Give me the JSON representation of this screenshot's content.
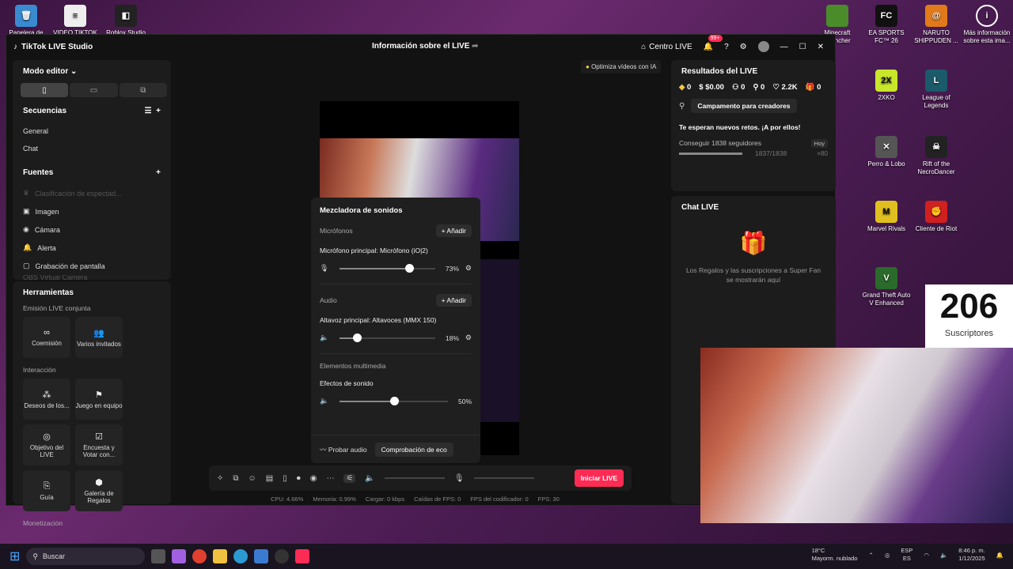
{
  "desktop": {
    "icons_left": [
      "Papelera de reciclaje",
      "VIDEO TIKTOK PC",
      "Roblox Studio"
    ],
    "icons_right": [
      {
        "label": "Minecraft Launcher",
        "color": "#4a8c2a"
      },
      {
        "label": "EA SPORTS FC™ 26",
        "color": "#111"
      },
      {
        "label": "NARUTO SHIPPUDEN ...",
        "color": "#e07a1a"
      },
      {
        "label": "Más información sobre esta ima...",
        "color": "#444"
      },
      {
        "label": "2XKO",
        "color": "#c8e62a"
      },
      {
        "label": "League of Legends",
        "color": "#1a5a6a"
      },
      {
        "label": "Perro & Lobo",
        "color": "#666"
      },
      {
        "label": "Rift of the NecroDancer",
        "color": "#222"
      },
      {
        "label": "Marvel Rivals",
        "color": "#e0c020"
      },
      {
        "label": "Cliente de Riot",
        "color": "#d02020"
      },
      {
        "label": "Grand Theft Auto V Enhanced",
        "color": "#2a6a2a"
      }
    ]
  },
  "window": {
    "app_title": "TikTok LIVE Studio",
    "center_title": "Información sobre el LIVE",
    "centro": "Centro LIVE",
    "notif": "99+"
  },
  "left": {
    "mode": "Modo editor",
    "sequences": "Secuencias",
    "seq_items": [
      "General",
      "Chat"
    ],
    "sources": "Fuentes",
    "source_items": [
      "Clasificación de espectad...",
      "Imagen",
      "Cámara",
      "Alerta",
      "Grabación de pantalla",
      "OBS Virtual Camera"
    ],
    "tools": "Herramientas",
    "cohost_title": "Emisión LIVE conjunta",
    "cohost": [
      "Coemisión",
      "Varios invitados"
    ],
    "interaction_title": "Interacción",
    "interaction": [
      "Deseos de los...",
      "Juego en equipo",
      "Objetivo del LIVE",
      "Encuesta y Votar con...",
      "Guía",
      "Galería de Regalos"
    ],
    "monet": "Monetización"
  },
  "center": {
    "ai_tip": "Optimiza vídeos con IA",
    "live_btn": "Iniciar LIVE"
  },
  "mixer": {
    "title": "Mezcladora de sonidos",
    "mic_section": "Micrófonos",
    "add": "Añadir",
    "mic_device": "Micrófono principal: Micrófono (iO|2)",
    "mic_pct": "73%",
    "mic_val": 73,
    "audio_section": "Audio",
    "spk_device": "Altavoz principal: Altavoces (MMX 150)",
    "spk_pct": "18%",
    "spk_val": 18,
    "media_section": "Elementos multimedia",
    "fx": "Efectos de sonido",
    "fx_pct": "50%",
    "fx_val": 50,
    "test": "Probar audio",
    "echo": "Comprobación de eco"
  },
  "stats": [
    "CPU: 4.66%",
    "Memoria: 0.99%",
    "Cargar: 0 kbps",
    "Caídas de FPS: 0",
    "FPS del codificador: 0",
    "FPS: 30"
  ],
  "right": {
    "results": "Resultados del LIVE",
    "vals": [
      "0",
      "$0.00",
      "0",
      "0",
      "2.2K",
      "0"
    ],
    "camp": "Campamento para creadores",
    "challenge": "Te esperan nuevos retos. ¡A por ellos!",
    "goal": "Conseguir 1838 seguidores",
    "today": "Hoy",
    "progress": "1837/1838",
    "reward": "×80",
    "chat": "Chat LIVE",
    "chat_msg": "Los Regalos y las suscripciones a Super Fan se mostrarán aquí"
  },
  "subs": {
    "count": "206",
    "label": "Suscriptores"
  },
  "taskbar": {
    "search": "Buscar",
    "weather_temp": "18°C",
    "weather": "Mayorm. nublado",
    "lang1": "ESP",
    "lang2": "ES",
    "time": "8:46 p. m.",
    "date": "1/12/2025"
  }
}
